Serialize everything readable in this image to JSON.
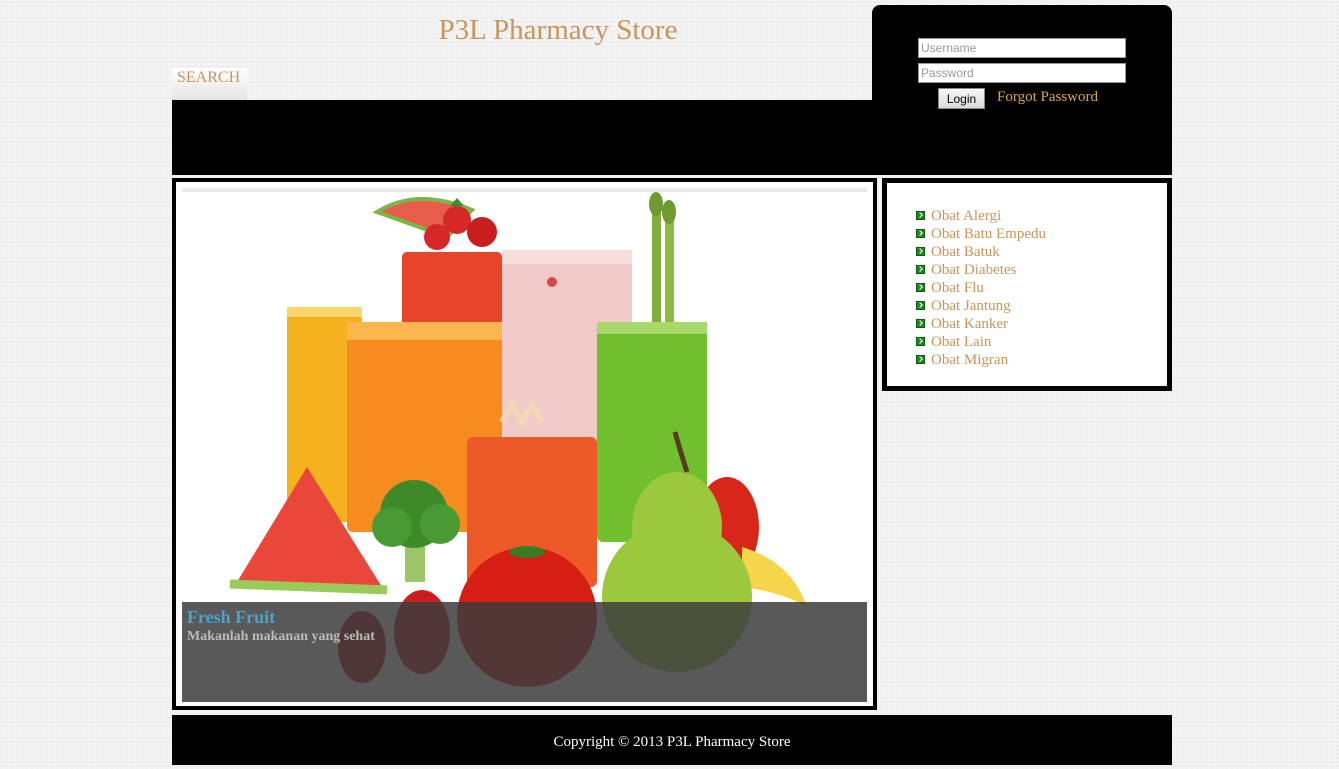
{
  "header": {
    "site_title": "P3L Pharmacy Store",
    "search_tab_label": "SEARCH"
  },
  "login": {
    "username_placeholder": "Username",
    "password_placeholder": "Password",
    "login_button_label": "Login",
    "forgot_password_label": "Forgot Password"
  },
  "slider": {
    "caption_title": "Fresh Fruit",
    "caption_text": "Makanlah makanan yang sehat"
  },
  "categories": {
    "items": [
      {
        "label": "Obat Alergi"
      },
      {
        "label": "Obat Batu Empedu"
      },
      {
        "label": "Obat Batuk"
      },
      {
        "label": "Obat Diabetes"
      },
      {
        "label": "Obat Flu"
      },
      {
        "label": "Obat Jantung"
      },
      {
        "label": "Obat Kanker"
      },
      {
        "label": "Obat Lain"
      },
      {
        "label": "Obat Migran"
      }
    ]
  },
  "footer": {
    "copyright": "Copyright © 2013 P3L Pharmacy Store"
  },
  "colors": {
    "link": "#c8955a",
    "forgot_link": "#d9a84e",
    "caption_title": "#4aa3c9",
    "bullet": "#1f8a1f",
    "bar": "#000000"
  }
}
